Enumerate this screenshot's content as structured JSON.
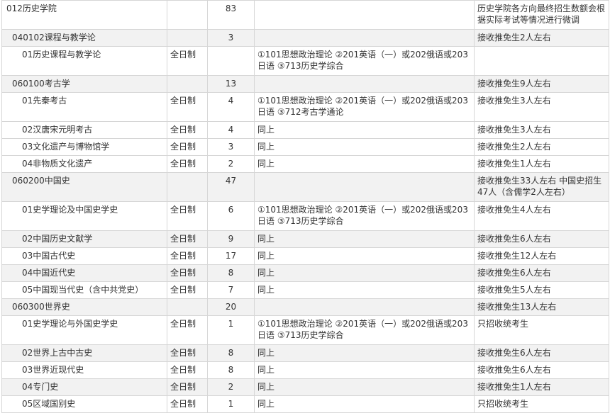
{
  "rows": [
    {
      "name": "012历史学院",
      "mode": "",
      "count": "83",
      "exam": "",
      "note": "历史学院各方向最终招生数额会根据实际考试等情况进行微调",
      "level": "dept"
    },
    {
      "name": "040102课程与教学论",
      "mode": "",
      "count": "3",
      "exam": "",
      "note": "接收推免生2人左右",
      "level": "major"
    },
    {
      "name": "01历史课程与教学论",
      "mode": "全日制",
      "count": "",
      "exam": "①101思想政治理论 ②201英语（一）或202俄语或203日语 ③713历史学综合",
      "note": "",
      "level": "dir"
    },
    {
      "name": "060100考古学",
      "mode": "",
      "count": "13",
      "exam": "",
      "note": "接收推免生9人左右",
      "level": "major"
    },
    {
      "name": "01先秦考古",
      "mode": "全日制",
      "count": "4",
      "exam": "①101思想政治理论 ②201英语（一）或202俄语或203日语 ③712考古学通论",
      "note": "接收推免生3人左右",
      "level": "dir"
    },
    {
      "name": "02汉唐宋元明考古",
      "mode": "全日制",
      "count": "4",
      "exam": "同上",
      "note": "接收推免生3人左右",
      "level": "dir"
    },
    {
      "name": "03文化遗产与博物馆学",
      "mode": "全日制",
      "count": "3",
      "exam": "同上",
      "note": "接收推免生2人左右",
      "level": "dir"
    },
    {
      "name": "04非物质文化遗产",
      "mode": "全日制",
      "count": "2",
      "exam": "同上",
      "note": "接收推免生1人左右",
      "level": "dir"
    },
    {
      "name": "060200中国史",
      "mode": "",
      "count": "47",
      "exam": "",
      "note": "接收推免生33人左右 中国史招生47人（含儒学2人左右）",
      "level": "major"
    },
    {
      "name": "01史学理论及中国史学史",
      "mode": "全日制",
      "count": "6",
      "exam": "①101思想政治理论 ②201英语（一）或202俄语或203日语 ③713历史学综合",
      "note": "接收推免生4人左右",
      "level": "dir"
    },
    {
      "name": "02中国历史文献学",
      "mode": "全日制",
      "count": "9",
      "exam": "同上",
      "note": "接收推免生6人左右",
      "level": "dir"
    },
    {
      "name": "03中国古代史",
      "mode": "全日制",
      "count": "17",
      "exam": "同上",
      "note": "接收推免生12人左右",
      "level": "dir"
    },
    {
      "name": "04中国近代史",
      "mode": "全日制",
      "count": "8",
      "exam": "同上",
      "note": "接收推免生6人左右",
      "level": "dir"
    },
    {
      "name": "05中国现当代史（含中共党史）",
      "mode": "全日制",
      "count": "7",
      "exam": "同上",
      "note": "接收推免生5人左右",
      "level": "dir"
    },
    {
      "name": "060300世界史",
      "mode": "",
      "count": "20",
      "exam": "",
      "note": "接收推免生13人左右",
      "level": "major"
    },
    {
      "name": "01史学理论与外国史学史",
      "mode": "全日制",
      "count": "1",
      "exam": "①101思想政治理论 ②201英语（一）或202俄语或203日语 ③713历史学综合",
      "note": "只招收统考生",
      "level": "dir"
    },
    {
      "name": "02世界上古中古史",
      "mode": "全日制",
      "count": "8",
      "exam": "同上",
      "note": "接收推免生6人左右",
      "level": "dir"
    },
    {
      "name": "03世界近现代史",
      "mode": "全日制",
      "count": "8",
      "exam": "同上",
      "note": "接收推免生6人左右",
      "level": "dir"
    },
    {
      "name": "04专门史",
      "mode": "全日制",
      "count": "2",
      "exam": "同上",
      "note": "接收推免生1人左右",
      "level": "dir"
    },
    {
      "name": "05区域国别史",
      "mode": "全日制",
      "count": "1",
      "exam": "同上",
      "note": "只招收统考生",
      "level": "dir"
    }
  ]
}
